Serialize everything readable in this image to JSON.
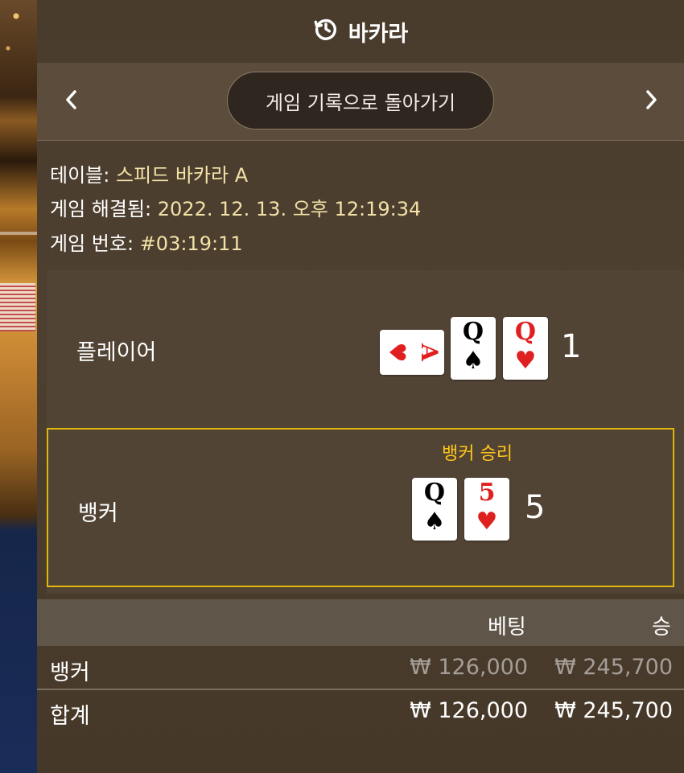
{
  "header": {
    "title": "바카라",
    "icon": "history-icon"
  },
  "nav": {
    "back_label": "게임 기록으로 돌아가기",
    "prev_icon": "chevron-left-icon",
    "next_icon": "chevron-right-icon"
  },
  "info": {
    "table_label": "테이블:",
    "table_value": "스피드 바카라 A",
    "resolved_label": "게임 해결됨:",
    "resolved_value": "2022. 12. 13. 오후 12:19:34",
    "number_label": "게임 번호:",
    "number_value": "#03:19:11"
  },
  "player": {
    "label": "플레이어",
    "score": "1",
    "cards": [
      {
        "rank": "A",
        "suit": "♥",
        "color": "red",
        "orientation": "sideways"
      },
      {
        "rank": "Q",
        "suit": "♠",
        "color": "black",
        "orientation": "upright"
      },
      {
        "rank": "Q",
        "suit": "♥",
        "color": "red",
        "orientation": "upright"
      }
    ]
  },
  "banker": {
    "label": "뱅커",
    "score": "5",
    "win_label": "뱅커 승리",
    "cards": [
      {
        "rank": "Q",
        "suit": "♠",
        "color": "black",
        "orientation": "upright"
      },
      {
        "rank": "5",
        "suit": "♥",
        "color": "red",
        "orientation": "upright"
      }
    ]
  },
  "bets": {
    "columns": {
      "bet": "베팅",
      "win": "승"
    },
    "rows": [
      {
        "name": "뱅커",
        "bet": "₩ 126,000",
        "win": "₩ 245,700"
      }
    ],
    "total": {
      "name": "합계",
      "bet": "₩ 126,000",
      "win": "₩ 245,700"
    }
  },
  "colors": {
    "win_accent": "#ffc61a",
    "red_suit": "#e02020",
    "banker_border": "#e0b80a"
  }
}
